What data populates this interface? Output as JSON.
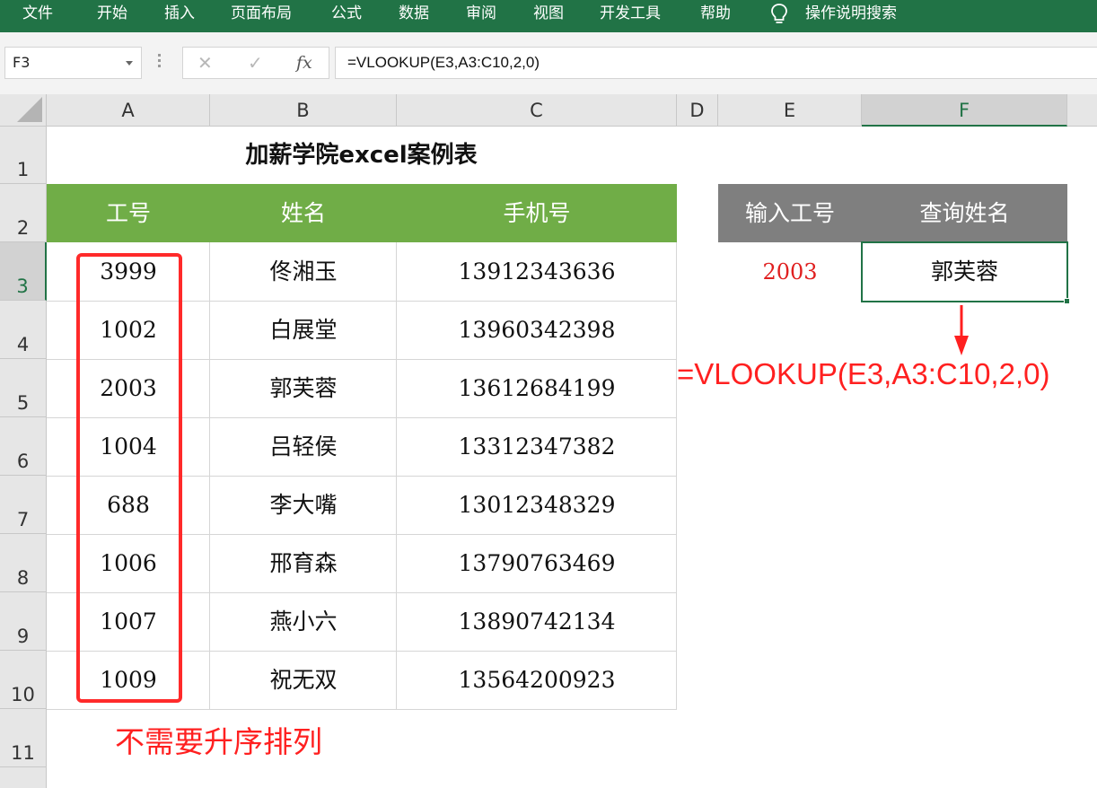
{
  "ribbon": {
    "items": [
      "文件",
      "开始",
      "插入",
      "页面布局",
      "公式",
      "数据",
      "审阅",
      "视图",
      "开发工具",
      "帮助"
    ],
    "search_label": "操作说明搜索",
    "icon": "lightbulb-icon"
  },
  "formula_bar": {
    "name_box": "F3",
    "cancel_icon": "✕",
    "enter_icon": "✓",
    "fx_label": "fx",
    "formula": "=VLOOKUP(E3,A3:C10,2,0)"
  },
  "columns": [
    "A",
    "B",
    "C",
    "D",
    "E",
    "F"
  ],
  "selected_column": "F",
  "rows": [
    "1",
    "2",
    "3",
    "4",
    "5",
    "6",
    "7",
    "8",
    "9",
    "10",
    "11"
  ],
  "selected_row": "3",
  "sheet": {
    "title": "加薪学院excel案例表",
    "table_headers": [
      "工号",
      "姓名",
      "手机号"
    ],
    "table_rows": [
      [
        "3999",
        "佟湘玉",
        "13912343636"
      ],
      [
        "1002",
        "白展堂",
        "13960342398"
      ],
      [
        "2003",
        "郭芙蓉",
        "13612684199"
      ],
      [
        "1004",
        "吕轻侯",
        "13312347382"
      ],
      [
        "688",
        "李大嘴",
        "13012348329"
      ],
      [
        "1006",
        "邢育森",
        "13790763469"
      ],
      [
        "1007",
        "燕小六",
        "13890742134"
      ],
      [
        "1009",
        "祝无双",
        "13564200923"
      ]
    ],
    "lookup_headers": [
      "输入工号",
      "查询姓名"
    ],
    "lookup_input": "2003",
    "lookup_result": "郭芙蓉"
  },
  "annotations": {
    "note": "不需要升序排列",
    "formula": "=VLOOKUP(E3,A3:C10,2,0)"
  },
  "colors": {
    "ribbon": "#217346",
    "table_header": "#70ad47",
    "lookup_header": "#7f7f7f",
    "annotation": "#ff2020",
    "input_value": "#e02020"
  }
}
